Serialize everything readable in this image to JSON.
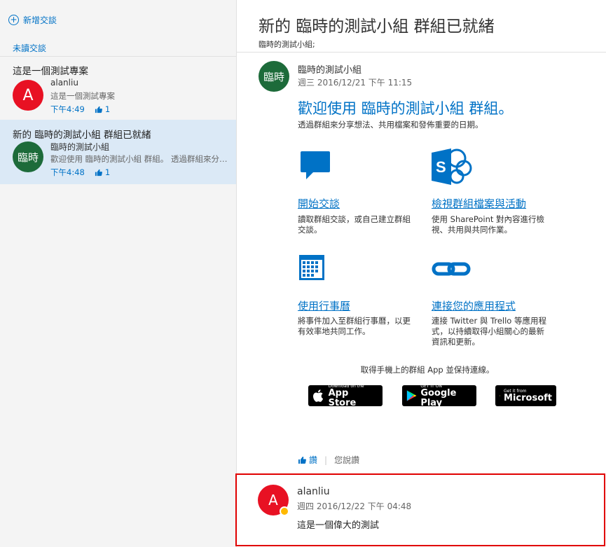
{
  "sidebar": {
    "new_conversation": "新增交談",
    "unread_label": "未讀交談",
    "conversations": [
      {
        "subject": "這是一個測試專案",
        "avatar_text": "A",
        "avatar_color": "#e81123",
        "sender": "alanliu",
        "preview": "這是一個測試專案",
        "time": "下午4:49",
        "likes": "1"
      },
      {
        "subject": "新的 臨時的測試小組 群組已就緒",
        "avatar_text": "臨時",
        "avatar_color": "#1d6b3a",
        "sender": "臨時的測試小組",
        "preview": "歡迎使用 臨時的測試小組 群組。 透過群組來分享想法、共用檔案和發佈重要的日期。",
        "time": "下午4:48",
        "likes": "1",
        "selected": true
      }
    ]
  },
  "conversation": {
    "title": "新的 臨時的測試小組 群組已就緒",
    "recipients": "臨時的測試小組;",
    "message": {
      "avatar_text": "臨時",
      "sender": "臨時的測試小組",
      "date": "週三 2016/12/21 下午 11:15",
      "welcome_title": "歡迎使用 臨時的測試小組 群組。",
      "welcome_subtitle": "透過群組來分享想法、共用檔案和發佈重要的日期。",
      "features": [
        {
          "icon": "chat-bubble-icon",
          "link": "開始交談",
          "desc": "讀取群組交談，或自己建立群組交談。"
        },
        {
          "icon": "sharepoint-icon",
          "link": "檢視群組檔案與活動",
          "desc": "使用 SharePoint 對內容進行檢視、共用與共同作業。"
        },
        {
          "icon": "calendar-icon",
          "link": "使用行事曆",
          "desc": "將事件加入至群組行事曆，以更有效率地共同工作。"
        },
        {
          "icon": "link-icon",
          "link": "連接您的應用程式",
          "desc": "連接 Twitter 與 Trello 等應用程式，以持續取得小組關心的最新資訊和更新。"
        }
      ],
      "app_promo": "取得手機上的群組 App 並保持連線。",
      "stores": {
        "apple_small": "Download on the",
        "apple_big": "App Store",
        "google_small": "GET IT ON",
        "google_big": "Google Play",
        "ms_small": "Get it from",
        "ms_big": "Microsoft"
      },
      "like_label": "讚",
      "you_liked": "您說讚"
    },
    "reply": {
      "avatar_text": "A",
      "sender": "alanliu",
      "date": "週四 2016/12/22 下午 04:48",
      "body": "這是一個偉大的測試"
    }
  },
  "colors": {
    "accent": "#0072c6",
    "highlight": "#dbe9f6",
    "reply_border": "#e00000"
  }
}
